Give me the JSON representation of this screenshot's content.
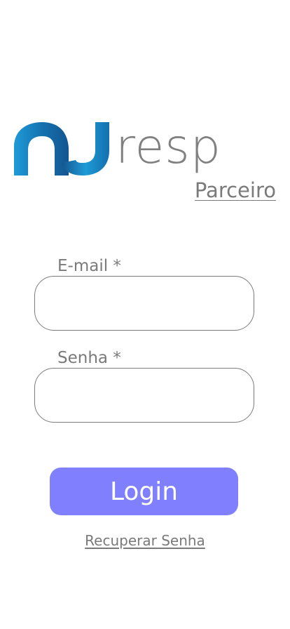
{
  "logo": {
    "wordmark": "resp",
    "colors": {
      "dark_blue": "#14558f",
      "light_blue": "#1e9bd7",
      "gray": "#808080"
    }
  },
  "header": {
    "subtitle": "Parceiro"
  },
  "form": {
    "email_label": "E-mail *",
    "email_value": "",
    "password_label": "Senha *",
    "password_value": ""
  },
  "actions": {
    "login_label": "Login",
    "recover_label": "Recuperar Senha",
    "button_color": "#8080ff"
  }
}
